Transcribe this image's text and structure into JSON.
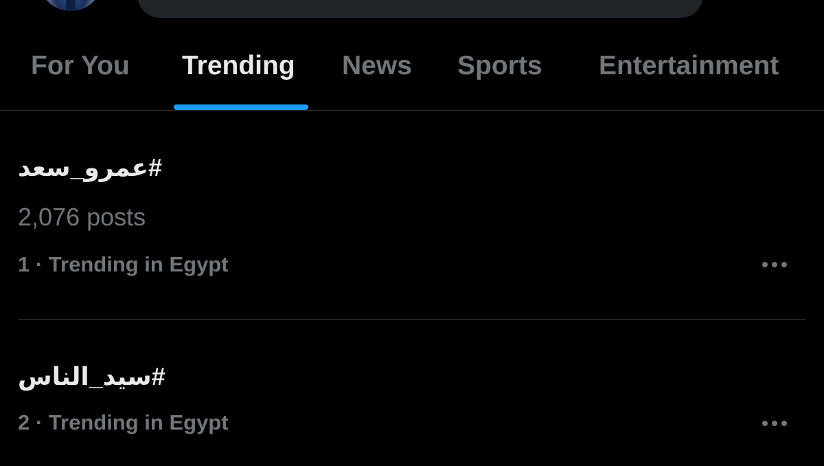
{
  "colors": {
    "background": "#000000",
    "text_primary": "#e7e9ea",
    "text_secondary": "#71767b",
    "accent": "#1d9bf0",
    "divider": "#2f3336",
    "search_bg": "#202327"
  },
  "header": {
    "avatar_icon": "user-avatar",
    "tabs": [
      {
        "label": "For You",
        "active": false
      },
      {
        "label": "Trending",
        "active": true
      },
      {
        "label": "News",
        "active": false
      },
      {
        "label": "Sports",
        "active": false
      },
      {
        "label": "Entertainment",
        "active": false
      }
    ]
  },
  "trends": [
    {
      "title": "#عمرو_سعد",
      "posts": "2,076 posts",
      "meta": "1 · Trending in Egypt",
      "more_icon": "more-horizontal-icon"
    },
    {
      "title": "#سيد_الناس",
      "meta": "2 · Trending in Egypt",
      "more_icon": "more-horizontal-icon"
    }
  ]
}
